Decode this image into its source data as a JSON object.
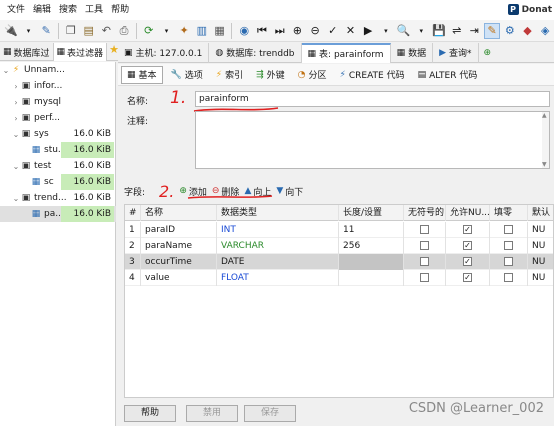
{
  "menu": [
    "文件",
    "编辑",
    "搜索",
    "工具",
    "帮助"
  ],
  "brand": "Donat",
  "sidebar_tabs": [
    {
      "label": "数据库过"
    },
    {
      "label": "表过滤器"
    }
  ],
  "tree": [
    {
      "label": "Unnam...",
      "size": "",
      "icon": "server-icon",
      "depth": 0,
      "expanded": true
    },
    {
      "label": "infor...",
      "size": "",
      "icon": "database-icon",
      "depth": 1,
      "expanded": false
    },
    {
      "label": "mysql",
      "size": "",
      "icon": "database-icon",
      "depth": 1,
      "expanded": false
    },
    {
      "label": "perf...",
      "size": "",
      "icon": "database-icon",
      "depth": 1,
      "expanded": false
    },
    {
      "label": "sys",
      "size": "16.0 KiB",
      "icon": "database-icon",
      "depth": 1,
      "expanded": true
    },
    {
      "label": "stu...",
      "size": "16.0 KiB",
      "icon": "table-icon",
      "depth": 2,
      "hl": true
    },
    {
      "label": "test",
      "size": "16.0 KiB",
      "icon": "database-icon",
      "depth": 1,
      "expanded": true
    },
    {
      "label": "sc",
      "size": "16.0 KiB",
      "icon": "table-icon",
      "depth": 2,
      "hl": true
    },
    {
      "label": "trend...",
      "size": "16.0 KiB",
      "icon": "database-icon",
      "depth": 1,
      "expanded": true
    },
    {
      "label": "pa...",
      "size": "16.0 KiB",
      "icon": "table-icon",
      "depth": 2,
      "hl": true,
      "selected": true
    }
  ],
  "top_tabs": [
    {
      "label": "主机: 127.0.0.1"
    },
    {
      "label": "数据库: trenddb"
    },
    {
      "label": "表: parainform",
      "active": true
    },
    {
      "label": "数据"
    },
    {
      "label": "查询*"
    }
  ],
  "sub_tabs": [
    {
      "label": "基本",
      "active": true
    },
    {
      "label": "选项"
    },
    {
      "label": "索引"
    },
    {
      "label": "外键"
    },
    {
      "label": "分区"
    },
    {
      "label": "CREATE 代码"
    },
    {
      "label": "ALTER 代码"
    }
  ],
  "form": {
    "name_label": "名称:",
    "name_value": "parainform",
    "comment_label": "注释:",
    "comment_value": ""
  },
  "annotations": {
    "one": "1.",
    "two": "2."
  },
  "columns_bar": {
    "label": "字段:",
    "add": "添加",
    "delete": "删除",
    "up": "向上",
    "down": "向下"
  },
  "grid": {
    "headers": [
      "#",
      "名称",
      "数据类型",
      "长度/设置",
      "无符号的",
      "允许NU...",
      "填零",
      "默认"
    ],
    "rows": [
      {
        "num": "1",
        "name": "paraID",
        "type": "INT",
        "length": "11",
        "unsigned": false,
        "nullable": true,
        "zerofill": false,
        "default": "NU"
      },
      {
        "num": "2",
        "name": "paraName",
        "type": "VARCHAR",
        "length": "256",
        "unsigned": false,
        "nullable": true,
        "zerofill": false,
        "default": "NU"
      },
      {
        "num": "3",
        "name": "occurTime",
        "type": "DATE",
        "length": "",
        "unsigned": false,
        "nullable": true,
        "zerofill": false,
        "default": "NU",
        "selected": true
      },
      {
        "num": "4",
        "name": "value",
        "type": "FLOAT",
        "length": "",
        "unsigned": false,
        "nullable": true,
        "zerofill": false,
        "default": "NU"
      }
    ]
  },
  "buttons": {
    "help": "帮助",
    "discard": "禁用",
    "save": "保存"
  },
  "watermark": "CSDN @Learner_002"
}
